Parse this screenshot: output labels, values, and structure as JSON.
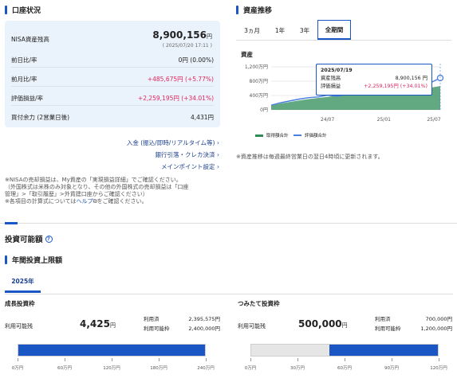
{
  "nisa": {
    "title": "口座状況",
    "balance_label": "NISA資産残高",
    "balance_value": "8,900,156",
    "balance_unit": "円",
    "balance_date": "( 2025/07/20 17:11 )",
    "rows": [
      {
        "label": "前日比/率",
        "value": "0円 (0.00%)",
        "color": "#222222"
      },
      {
        "label": "前月比/率",
        "value": "+485,675円 (+5.77%)",
        "color": "#e0245e"
      },
      {
        "label": "評価損益/率",
        "value": "+2,259,195円 (+34.01%)",
        "color": "#e0245e"
      },
      {
        "label": "買付余力 (2営業日後)",
        "value": "4,431円",
        "color": "#222222"
      }
    ],
    "links": [
      "入金 (振込/即時/リアルタイム等)",
      "銀行引落・クレカ決済",
      "メインポイント設定"
    ],
    "notes": [
      "※NISAの売却損益は、My資産の「実現損益詳細」でご確認ください。",
      "（外国株式は米株のみ対象となり、その他の外国株式の売却損益は「口座",
      "管理」>「取引履歴」>外貨建口座からご確認ください）",
      "※各項目の計算式については"
    ],
    "help_link": "ヘルプ",
    "help_suffix": "をご確認ください。"
  },
  "trend": {
    "title": "資産推移",
    "tabs": [
      "3ヵ月",
      "1年",
      "3年",
      "全期間"
    ],
    "active_tab": "全期間",
    "chart_label": "資産",
    "legend": [
      "取得額合計",
      "評価額合計"
    ],
    "note": "※資産推移は毎週最終営業日の翌日4時頃に更新されます。",
    "tooltip": {
      "date": "2025/07/19",
      "balance_label": "資産残高",
      "balance_value": "8,900,156 円",
      "pl_label": "評価損益",
      "pl_value": "+2,259,195円",
      "pl_rate": "(+34.01%)"
    }
  },
  "chart_data": {
    "type": "area",
    "x_ticks": [
      "24/07",
      "25/01",
      "25/07"
    ],
    "y_ticks": [
      "1,200万円",
      "800万円",
      "400万円",
      "0円"
    ],
    "ylim": [
      0,
      1200
    ],
    "x": [
      "2024/01",
      "2024/02",
      "2024/03",
      "2024/04",
      "2024/05",
      "2024/06",
      "2024/07",
      "2024/08",
      "2024/09",
      "2024/10",
      "2024/11",
      "2024/12",
      "2025/01",
      "2025/02",
      "2025/03",
      "2025/04",
      "2025/05",
      "2025/06",
      "2025/07"
    ],
    "series": [
      {
        "name": "取得額合計",
        "color": "#2e8b57",
        "values": [
          120,
          180,
          220,
          260,
          300,
          330,
          360,
          400,
          420,
          440,
          460,
          480,
          500,
          520,
          540,
          560,
          590,
          620,
          664
        ]
      },
      {
        "name": "評価額合計",
        "color": "#4a7fe0",
        "values": [
          130,
          200,
          250,
          300,
          340,
          360,
          410,
          380,
          430,
          470,
          520,
          560,
          600,
          610,
          600,
          570,
          650,
          760,
          890
        ]
      }
    ]
  },
  "invest": {
    "title": "投資可能額",
    "subtitle": "年間投資上限額",
    "year_tab": "2025年",
    "growth": {
      "title": "成長投資枠",
      "avail_label": "利用可能残",
      "avail_value": "4,425",
      "avail_unit": "円",
      "used_label": "利用済",
      "used_value": "2,395,575円",
      "limit_label": "利用可能枠",
      "limit_value": "2,400,000円",
      "used_fraction": 0.998,
      "ticks": [
        "0万円",
        "60万円",
        "120万円",
        "180万円",
        "240万円"
      ]
    },
    "tsumitate": {
      "title": "つみたて投資枠",
      "avail_label": "利用可能残",
      "avail_value": "500,000",
      "avail_unit": "円",
      "used_label": "利用済",
      "used_value": "700,000円",
      "limit_label": "利用可能枠",
      "limit_value": "1,200,000円",
      "used_fraction": 0.583,
      "ticks": [
        "0万円",
        "30万円",
        "60万円",
        "90万円",
        "120万円"
      ]
    }
  }
}
